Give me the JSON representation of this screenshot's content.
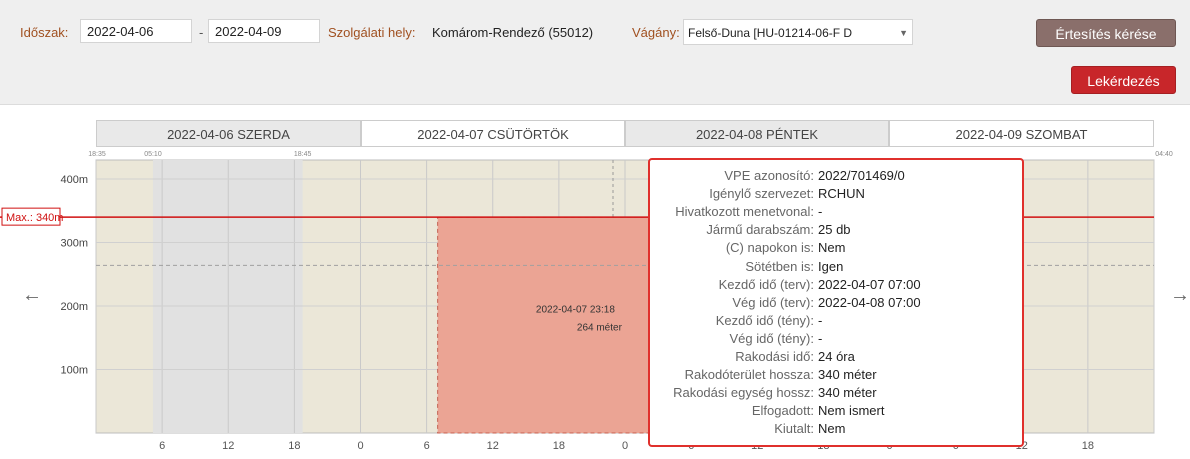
{
  "filters": {
    "period_label": "Időszak:",
    "date_from": "2022-04-06",
    "date_sep": "-",
    "date_to": "2022-04-09",
    "location_label": "Szolgálati hely:",
    "location_value": "Komárom-Rendező (55012)",
    "track_label": "Vágány:",
    "track_value": "Felső-Duna [HU-01214-06-F D"
  },
  "buttons": {
    "notify": "Értesítés kérése",
    "query": "Lekérdezés"
  },
  "days": [
    "2022-04-06  SZERDA",
    "2022-04-07  CSÜTÖRTÖK",
    "2022-04-08  PÉNTEK",
    "2022-04-09  SZOMBAT"
  ],
  "chart_data": {
    "type": "bar",
    "x_ticks": [
      "6",
      "12",
      "18",
      "0",
      "6",
      "12",
      "18",
      "0",
      "6",
      "12",
      "18",
      "0",
      "6",
      "12",
      "18"
    ],
    "y_ticks": [
      "100m",
      "200m",
      "300m",
      "400m"
    ],
    "ylim": [
      0,
      430
    ],
    "time_markers": [
      "18:35",
      "05:10",
      "18:45",
      "04:40"
    ],
    "max_line": {
      "label": "Max.: 340m",
      "value": 340
    },
    "dashed_level": 264,
    "block": {
      "start": "2022-04-07 07:00",
      "end": "2022-04-08 07:00",
      "length_m": 340,
      "label_time": "2022-04-07 23:18",
      "label_value": "264 méter"
    }
  },
  "tooltip": [
    {
      "key": "VPE azonosító:",
      "value": "2022/701469/0"
    },
    {
      "key": "Igénylő szervezet:",
      "value": "RCHUN"
    },
    {
      "key": "Hivatkozott menetvonal:",
      "value": "-"
    },
    {
      "key": "Jármű darabszám:",
      "value": "25 db"
    },
    {
      "key": "(C) napokon is:",
      "value": "Nem"
    },
    {
      "key": "Sötétben is:",
      "value": "Igen"
    },
    {
      "key": "Kezdő idő (terv):",
      "value": "2022-04-07 07:00"
    },
    {
      "key": "Vég idő (terv):",
      "value": "2022-04-08 07:00"
    },
    {
      "key": "Kezdő idő (tény):",
      "value": "-"
    },
    {
      "key": "Vég idő (tény):",
      "value": "-"
    },
    {
      "key": "Rakodási idő:",
      "value": "24 óra"
    },
    {
      "key": "Rakodóterület hossza:",
      "value": "340 méter"
    },
    {
      "key": "Rakodási egység hossz:",
      "value": "340 méter"
    },
    {
      "key": "Elfogadott:",
      "value": "Nem ismert"
    },
    {
      "key": "Kiutalt:",
      "value": "Nem"
    }
  ],
  "icons": {
    "prev": "arrow-left-icon",
    "next": "arrow-right-icon",
    "dropdown": "chevron-down-icon"
  }
}
